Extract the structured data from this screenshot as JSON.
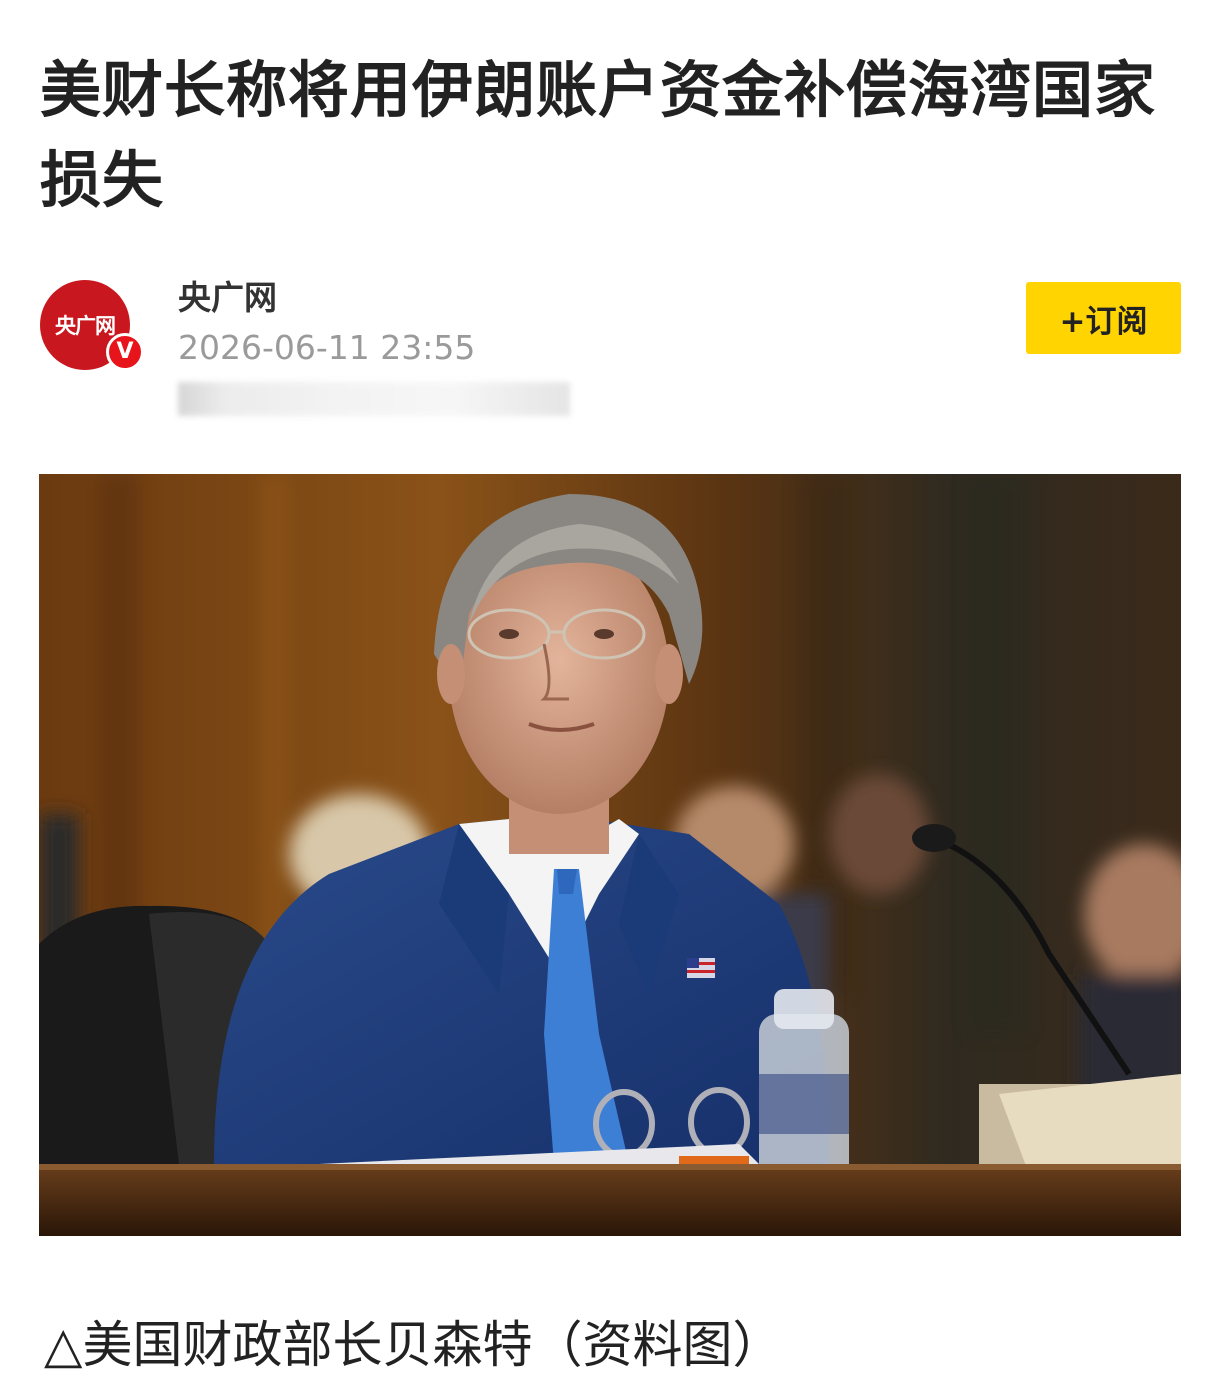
{
  "article": {
    "title": "美财长称将用伊朗账户资金补偿海湾国家损失",
    "source": {
      "name": "央广网",
      "logo_text": "央广网",
      "verified_badge": "V",
      "brand_color": "#c8171e"
    },
    "publish_time": "2026-06-11 23:55",
    "subscribe_label": "+订阅",
    "subscribe_color": "#ffd400",
    "photo_icon": "photo-of-official-at-hearing",
    "caption": "△美国财政部长贝森特（资料图）"
  }
}
